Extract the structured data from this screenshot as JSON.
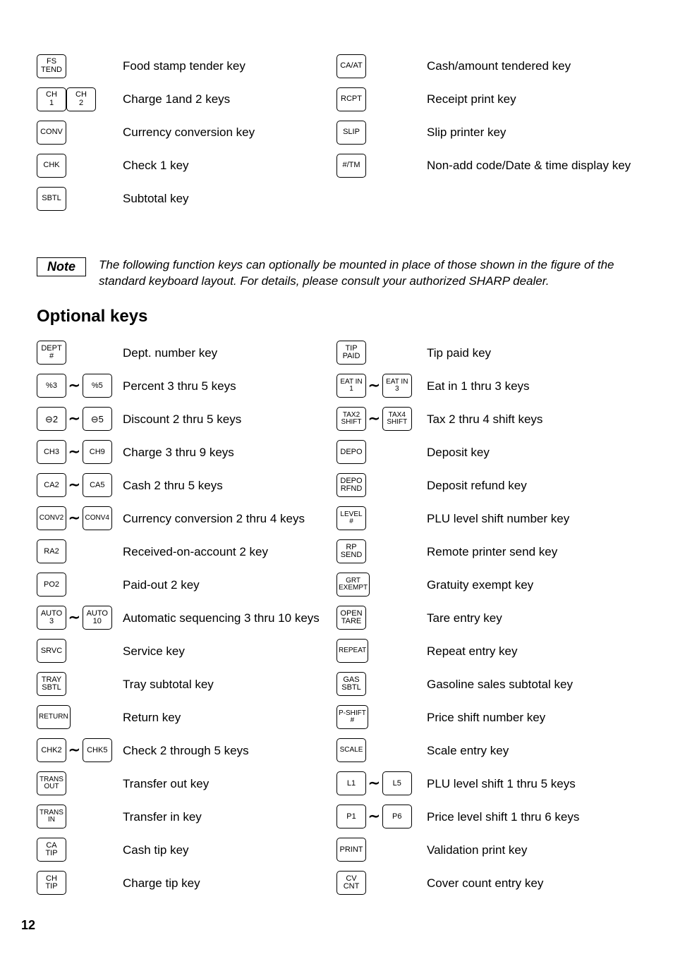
{
  "top_left": [
    {
      "keys": [
        {
          "lines": [
            "FS",
            "TEND"
          ]
        }
      ],
      "desc": "Food stamp tender key"
    },
    {
      "keys": [
        {
          "lines": [
            "CH",
            "1"
          ]
        },
        {
          "lines": [
            "CH",
            "2"
          ]
        }
      ],
      "desc": "Charge 1and 2 keys"
    },
    {
      "keys": [
        {
          "lines": [
            "CONV"
          ]
        }
      ],
      "desc": "Currency conversion key"
    },
    {
      "keys": [
        {
          "lines": [
            "CHK"
          ]
        }
      ],
      "desc": "Check 1 key"
    },
    {
      "keys": [
        {
          "lines": [
            "SBTL"
          ]
        }
      ],
      "desc": "Subtotal key"
    }
  ],
  "top_right": [
    {
      "keys": [
        {
          "lines": [
            "CA/AT"
          ]
        }
      ],
      "desc": "Cash/amount tendered key"
    },
    {
      "keys": [
        {
          "lines": [
            "RCPT"
          ]
        }
      ],
      "desc": "Receipt print key"
    },
    {
      "keys": [
        {
          "lines": [
            "SLIP"
          ]
        }
      ],
      "desc": "Slip printer key"
    },
    {
      "keys": [
        {
          "lines": [
            "#/TM"
          ]
        }
      ],
      "desc": "Non-add code/Date & time display key"
    }
  ],
  "note_label": "Note",
  "note_text": "The following function keys can optionally be mounted in place of those shown in the figure of the standard keyboard layout. For details, please consult your authorized SHARP dealer.",
  "heading": "Optional keys",
  "opt_left": [
    {
      "keys": [
        {
          "lines": [
            "DEPT",
            "#"
          ]
        }
      ],
      "desc": "Dept. number key"
    },
    {
      "keys": [
        {
          "lines": [
            "%3"
          ]
        },
        "tilde",
        {
          "lines": [
            "%5"
          ]
        }
      ],
      "desc": "Percent 3 thru 5 keys"
    },
    {
      "keys": [
        {
          "lines": [
            "⊖2"
          ],
          "ominus": true
        },
        "tilde",
        {
          "lines": [
            "⊖5"
          ],
          "ominus": true
        }
      ],
      "desc": "Discount 2 thru 5 keys"
    },
    {
      "keys": [
        {
          "lines": [
            "CH3"
          ]
        },
        "tilde",
        {
          "lines": [
            "CH9"
          ]
        }
      ],
      "desc": "Charge 3 thru 9 keys"
    },
    {
      "keys": [
        {
          "lines": [
            "CA2"
          ]
        },
        "tilde",
        {
          "lines": [
            "CA5"
          ]
        }
      ],
      "desc": "Cash 2 thru 5 keys"
    },
    {
      "keys": [
        {
          "lines": [
            "CONV2"
          ],
          "small": true
        },
        "tilde",
        {
          "lines": [
            "CONV4"
          ],
          "small": true
        }
      ],
      "desc": "Currency conversion 2 thru 4 keys"
    },
    {
      "keys": [
        {
          "lines": [
            "RA2"
          ]
        }
      ],
      "desc": "Received-on-account 2 key"
    },
    {
      "keys": [
        {
          "lines": [
            "PO2"
          ]
        }
      ],
      "desc": "Paid-out 2 key"
    },
    {
      "keys": [
        {
          "lines": [
            "AUTO",
            "3"
          ]
        },
        "tilde",
        {
          "lines": [
            "AUTO",
            "10"
          ]
        }
      ],
      "desc": "Automatic sequencing 3 thru 10 keys"
    },
    {
      "keys": [
        {
          "lines": [
            "SRVC"
          ]
        }
      ],
      "desc": "Service key"
    },
    {
      "keys": [
        {
          "lines": [
            "TRAY",
            "SBTL"
          ]
        }
      ],
      "desc": "Tray subtotal key"
    },
    {
      "keys": [
        {
          "lines": [
            "RETURN"
          ],
          "small": true
        }
      ],
      "desc": "Return key"
    },
    {
      "keys": [
        {
          "lines": [
            "CHK2"
          ]
        },
        "tilde",
        {
          "lines": [
            "CHK5"
          ]
        }
      ],
      "desc": "Check 2 through 5 keys"
    },
    {
      "keys": [
        {
          "lines": [
            "TRANS",
            "OUT"
          ],
          "small": true
        }
      ],
      "desc": "Transfer out key"
    },
    {
      "keys": [
        {
          "lines": [
            "TRANS",
            "IN"
          ],
          "small": true
        }
      ],
      "desc": "Transfer in key"
    },
    {
      "keys": [
        {
          "lines": [
            "CA",
            "TIP"
          ]
        }
      ],
      "desc": "Cash tip key"
    },
    {
      "keys": [
        {
          "lines": [
            "CH",
            "TIP"
          ]
        }
      ],
      "desc": "Charge tip key"
    }
  ],
  "opt_right": [
    {
      "keys": [
        {
          "lines": [
            "TIP",
            "PAID"
          ]
        }
      ],
      "desc": "Tip paid key"
    },
    {
      "keys": [
        {
          "lines": [
            "EAT IN",
            "1"
          ],
          "small": true
        },
        "tilde",
        {
          "lines": [
            "EAT IN",
            "3"
          ],
          "small": true
        }
      ],
      "desc": "Eat in 1 thru 3 keys"
    },
    {
      "keys": [
        {
          "lines": [
            "TAX2",
            "SHIFT"
          ],
          "small": true
        },
        "tilde",
        {
          "lines": [
            "TAX4",
            "SHIFT"
          ],
          "small": true
        }
      ],
      "desc": "Tax 2 thru 4 shift keys"
    },
    {
      "keys": [
        {
          "lines": [
            "DEPO"
          ]
        }
      ],
      "desc": "Deposit key"
    },
    {
      "keys": [
        {
          "lines": [
            "DEPO",
            "RFND"
          ]
        }
      ],
      "desc": "Deposit refund key"
    },
    {
      "keys": [
        {
          "lines": [
            "LEVEL",
            "#"
          ],
          "small": true
        }
      ],
      "desc": "PLU level shift number key"
    },
    {
      "keys": [
        {
          "lines": [
            "RP",
            "SEND"
          ]
        }
      ],
      "desc": "Remote printer send key"
    },
    {
      "keys": [
        {
          "lines": [
            "GRT",
            "EXEMPT"
          ],
          "small": true
        }
      ],
      "desc": "Gratuity exempt key"
    },
    {
      "keys": [
        {
          "lines": [
            "OPEN",
            "TARE"
          ]
        }
      ],
      "desc": "Tare entry key"
    },
    {
      "keys": [
        {
          "lines": [
            "REPEAT"
          ],
          "small": true
        }
      ],
      "desc": "Repeat entry key"
    },
    {
      "keys": [
        {
          "lines": [
            "GAS",
            "SBTL"
          ]
        }
      ],
      "desc": "Gasoline sales subtotal key"
    },
    {
      "keys": [
        {
          "lines": [
            "P-SHIFT",
            "#"
          ],
          "small": true
        }
      ],
      "desc": "Price shift number key"
    },
    {
      "keys": [
        {
          "lines": [
            "SCALE"
          ],
          "small": true
        }
      ],
      "desc": "Scale entry key"
    },
    {
      "keys": [
        {
          "lines": [
            "L1"
          ]
        },
        "tilde",
        {
          "lines": [
            "L5"
          ]
        }
      ],
      "desc": "PLU level shift 1 thru 5 keys"
    },
    {
      "keys": [
        {
          "lines": [
            "P1"
          ]
        },
        "tilde",
        {
          "lines": [
            "P6"
          ]
        }
      ],
      "desc": "Price level shift 1 thru 6 keys"
    },
    {
      "keys": [
        {
          "lines": [
            "PRINT"
          ]
        }
      ],
      "desc": "Validation print key"
    },
    {
      "keys": [
        {
          "lines": [
            "CV",
            "CNT"
          ]
        }
      ],
      "desc": "Cover count entry key"
    }
  ],
  "page_number": "12"
}
